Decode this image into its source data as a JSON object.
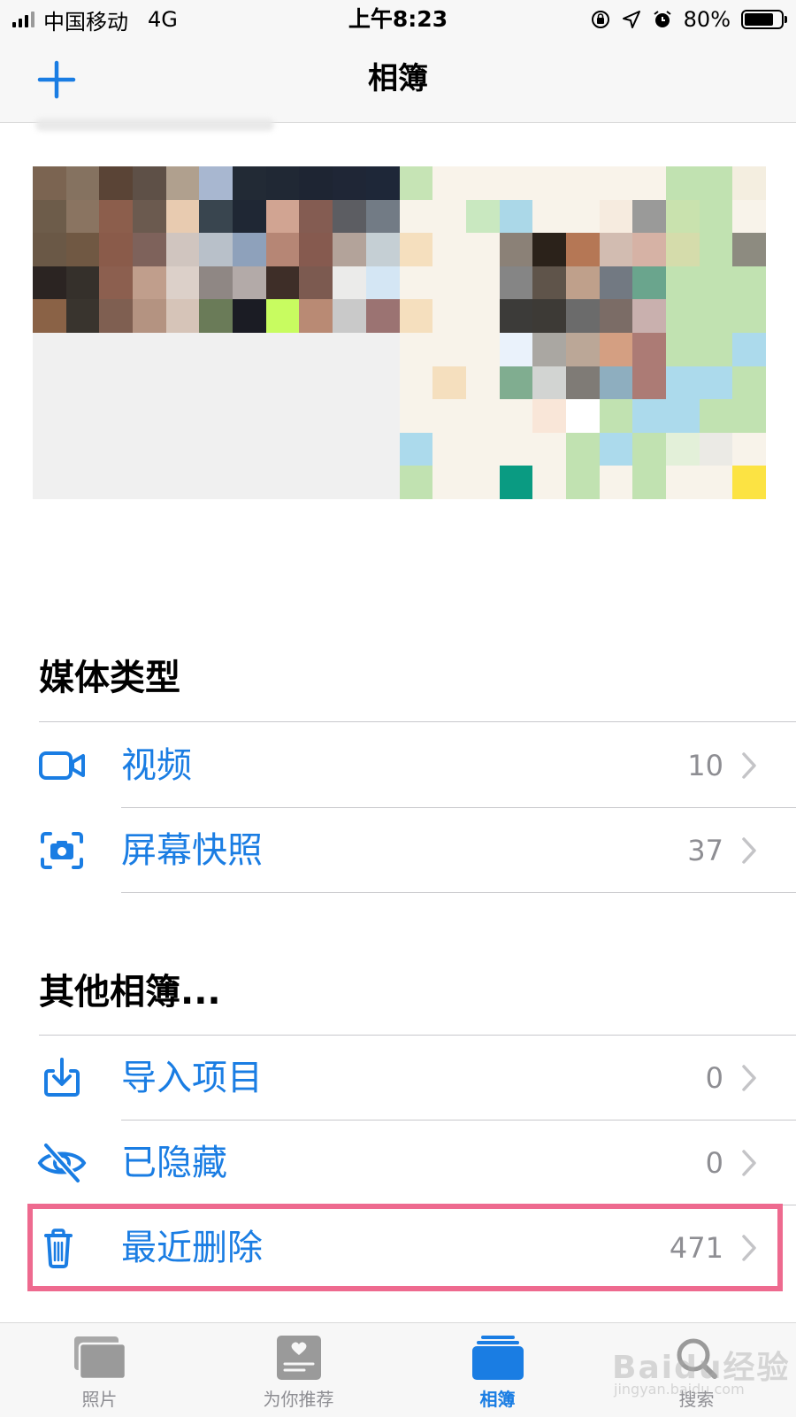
{
  "status_bar": {
    "carrier": "中国移动",
    "network": "4G",
    "time": "上午8:23",
    "battery": "80%",
    "battery_level": 0.8
  },
  "nav": {
    "title": "相簿",
    "add_icon": "plus-icon"
  },
  "mosaic_colors": [
    "#7b6451",
    "#857260",
    "#5a4436",
    "#5e5047",
    "#b0a08e",
    "#a8b7d0",
    "#222a35",
    "#202834",
    "#1e2533",
    "#1f2636",
    "#1e2738",
    "#c6e4b5",
    "#f9f3ea",
    "#f9f3ea",
    "#f9f3ea",
    "#f9f3ea",
    "#f9f3ea",
    "#f9f3ea",
    "#f9f3ea",
    "#c1e2b1",
    "#c1e2b1",
    "#f4eee0",
    "#6d5c4a",
    "#8a7461",
    "#8c5e4c",
    "#6b5a4f",
    "#e8cbb0",
    "#39454f",
    "#1f2734",
    "#d1a492",
    "#845c52",
    "#5c5d62",
    "#727b85",
    "#f8f3ea",
    "#f8f3ea",
    "#c9e8c0",
    "#abd8e8",
    "#f8f3ea",
    "#f8f3ea",
    "#f6ebdf",
    "#9a9a99",
    "#c9e2ae",
    "#c1e2b1",
    "#f8f3ea",
    "#6a5846",
    "#705843",
    "#8a5b4a",
    "#7e625b",
    "#d0c5bf",
    "#b8c0c9",
    "#8ea1bb",
    "#b68675",
    "#865a4f",
    "#b3a39a",
    "#c5cfd4",
    "#f5dfbe",
    "#f8f3ea",
    "#f8f3ea",
    "#8b8177",
    "#2b221a",
    "#b57755",
    "#d2bcb1",
    "#d6b2a5",
    "#d5dcab",
    "#c1e2b1",
    "#8d8b80",
    "#2b2422",
    "#35302b",
    "#8c5f4f",
    "#c09e8c",
    "#dcd0c9",
    "#8f8784",
    "#b3aaa8",
    "#3e2e28",
    "#7c5a50",
    "#ebebea",
    "#d4e6f4",
    "#f8f3ea",
    "#f8f3ea",
    "#f8f3ea",
    "#858585",
    "#5f544a",
    "#bfa08b",
    "#727982",
    "#6aa58d",
    "#c1e2b1",
    "#c1e2b1",
    "#c1e2b1",
    "#8a6246",
    "#39342e",
    "#7f5f51",
    "#b49381",
    "#d6c4b8",
    "#6a7b58",
    "#1b1c24",
    "#c8fc60",
    "#b98a74",
    "#c9c9c9",
    "#9b7372",
    "#f5dfbe",
    "#f8f3ea",
    "#f8f3ea",
    "#3c3b39",
    "#3d3a36",
    "#6b6b6b",
    "#7b6c66",
    "#c9b0ae",
    "#c1e2b1",
    "#c1e2b1",
    "#c1e2b1",
    "#f0f0f0",
    "#f0f0f0",
    "#f0f0f0",
    "#f0f0f0",
    "#f0f0f0",
    "#f0f0f0",
    "#f0f0f0",
    "#f0f0f0",
    "#f0f0f0",
    "#f0f0f0",
    "#f0f0f0",
    "#f8f3ea",
    "#f8f3ea",
    "#f8f3ea",
    "#eaf2fb",
    "#aaa7a2",
    "#bba797",
    "#d49f82",
    "#ac7b75",
    "#c1e2b1",
    "#c1e2b1",
    "#acdaec",
    "#f0f0f0",
    "#f0f0f0",
    "#f0f0f0",
    "#f0f0f0",
    "#f0f0f0",
    "#f0f0f0",
    "#f0f0f0",
    "#f0f0f0",
    "#f0f0f0",
    "#f0f0f0",
    "#f0f0f0",
    "#f8f3ea",
    "#f5dfbe",
    "#f8f3ea",
    "#80ad90",
    "#d2d4d2",
    "#7f7b76",
    "#8eaebf",
    "#ac7b75",
    "#acdaec",
    "#acdaec",
    "#c1e2b1",
    "#f0f0f0",
    "#f0f0f0",
    "#f0f0f0",
    "#f0f0f0",
    "#f0f0f0",
    "#f0f0f0",
    "#f0f0f0",
    "#f0f0f0",
    "#f0f0f0",
    "#f0f0f0",
    "#f0f0f0",
    "#f8f3ea",
    "#f8f3ea",
    "#f8f3ea",
    "#f8f3ea",
    "#f9e6d8",
    "#ffffff",
    "#c1e2b1",
    "#acdaec",
    "#acdaec",
    "#c1e2b1",
    "#c1e2b1",
    "#f0f0f0",
    "#f0f0f0",
    "#f0f0f0",
    "#f0f0f0",
    "#f0f0f0",
    "#f0f0f0",
    "#f0f0f0",
    "#f0f0f0",
    "#f0f0f0",
    "#f0f0f0",
    "#f0f0f0",
    "#acdaec",
    "#f8f3ea",
    "#f8f3ea",
    "#f8f3ea",
    "#f8f3ea",
    "#c1e2b1",
    "#acdaec",
    "#c1e2b1",
    "#e3f0d9",
    "#ebeae5",
    "#f8f3ea",
    "#f0f0f0",
    "#f0f0f0",
    "#f0f0f0",
    "#f0f0f0",
    "#f0f0f0",
    "#f0f0f0",
    "#f0f0f0",
    "#f0f0f0",
    "#f0f0f0",
    "#f0f0f0",
    "#f0f0f0",
    "#c1e2b1",
    "#f8f3ea",
    "#f8f3ea",
    "#0a9b82",
    "#f8f3ea",
    "#c1e2b1",
    "#f8f3ea",
    "#c1e2b1",
    "#f8f3ea",
    "#f8f3ea",
    "#fce343"
  ],
  "media_types": {
    "title": "媒体类型",
    "items": [
      {
        "icon": "video-camera-icon",
        "label": "视频",
        "count": "10"
      },
      {
        "icon": "screenshot-icon",
        "label": "屏幕快照",
        "count": "37"
      }
    ]
  },
  "other_albums": {
    "title": "其他相簿...",
    "items": [
      {
        "icon": "import-icon",
        "label": "导入项目",
        "count": "0"
      },
      {
        "icon": "eye-slash-icon",
        "label": "已隐藏",
        "count": "0"
      },
      {
        "icon": "trash-icon",
        "label": "最近删除",
        "count": "471"
      }
    ]
  },
  "tab_bar": {
    "tabs": [
      {
        "icon": "photos-icon",
        "label": "照片"
      },
      {
        "icon": "for-you-icon",
        "label": "为你推荐"
      },
      {
        "icon": "albums-icon",
        "label": "相簿",
        "active": true
      },
      {
        "icon": "search-icon",
        "label": "搜索"
      }
    ]
  },
  "watermark": {
    "text": "Baidu经验",
    "sub": "jingyan.baidu.com"
  },
  "colors": {
    "accent": "#1a7de3",
    "highlight_box": "#ee6a8f",
    "secondary_text": "#8e8e93"
  }
}
